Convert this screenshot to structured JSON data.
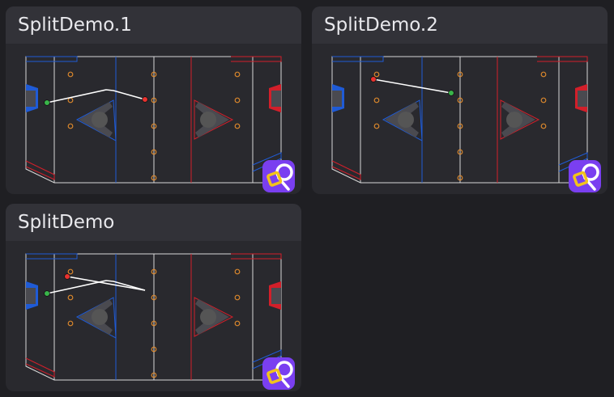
{
  "cards": [
    {
      "title": "SplitDemo.1"
    },
    {
      "title": "SplitDemo.2"
    },
    {
      "title": "SplitDemo"
    }
  ],
  "app_icon": "pathplanner-app-icon",
  "colors": {
    "background": "#1f1f23",
    "card": "#29292e",
    "card_header": "#323238",
    "blue_alliance": "#1f5bd6",
    "red_alliance": "#d21f2a",
    "start_marker": "#39b54a",
    "end_marker": "#e8322f",
    "game_piece": "#d9862c",
    "app_icon": "#7a3ff0"
  }
}
